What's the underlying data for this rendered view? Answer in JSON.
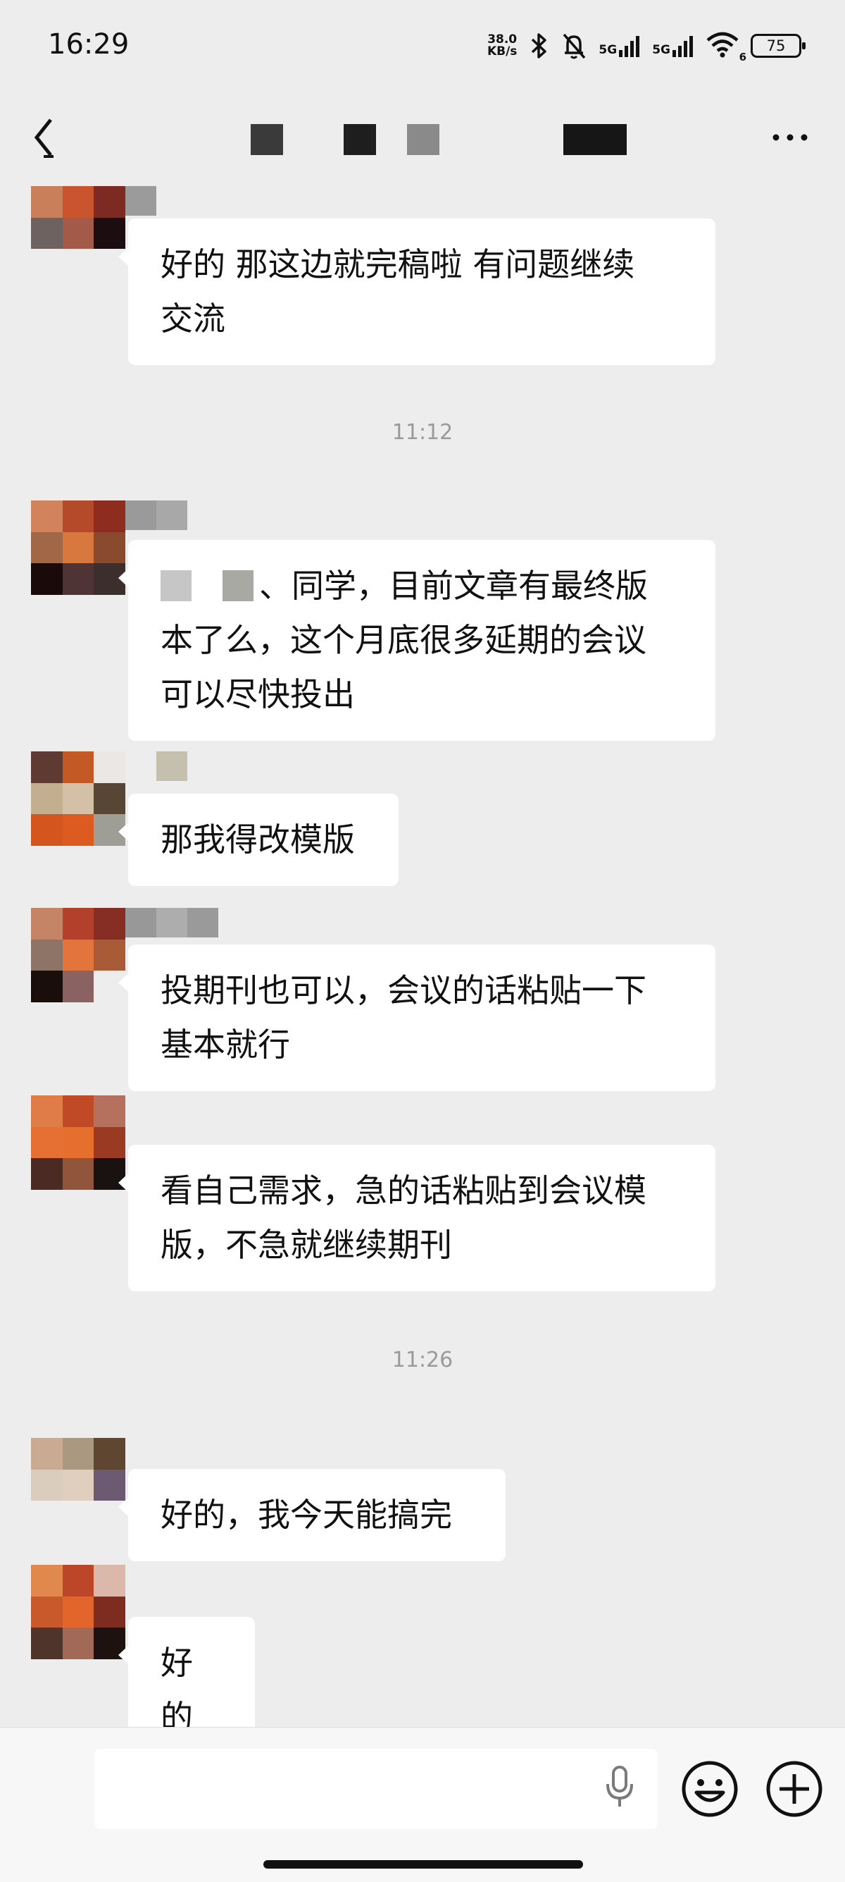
{
  "status_bar": {
    "time": "16:29",
    "net_speed_value": "38.0",
    "net_speed_unit": "KB/s",
    "signal_1": "5G",
    "signal_2": "5G",
    "wifi_sub": "6",
    "battery": "75",
    "icons": [
      "bluetooth-icon",
      "bell-muted-icon",
      "signal-icon",
      "wifi-icon",
      "battery-icon"
    ]
  },
  "nav": {
    "back_icon": "chevron-left-icon",
    "more_icon": "more-icon"
  },
  "messages": [
    {
      "text_lines": [
        "好的 那这边就完稿啦 有问题继续",
        "交流"
      ]
    },
    {
      "time": "11:12"
    },
    {
      "text_lines": [
        "、同学，目前文章有最终版",
        "本了么，这个月底很多延期的会议",
        "可以尽快投出"
      ]
    },
    {
      "text_lines": [
        "那我得改模版"
      ]
    },
    {
      "text_lines": [
        "投期刊也可以，会议的话粘贴一下",
        "基本就行"
      ]
    },
    {
      "text_lines": [
        "看自己需求，急的话粘贴到会议模",
        "版，不急就继续期刊"
      ]
    },
    {
      "time": "11:26"
    },
    {
      "text_lines": [
        "好的，我今天能搞完"
      ]
    },
    {
      "text_lines": [
        "好的"
      ]
    }
  ],
  "input_bar": {
    "text_value": "",
    "mic_icon": "microphone-icon",
    "emoji_icon": "smiley-icon",
    "plus_icon": "plus-circle-icon"
  },
  "colors": {
    "background": "#ededed",
    "bubble": "#ffffff",
    "time_label": "#9a9a9a"
  }
}
